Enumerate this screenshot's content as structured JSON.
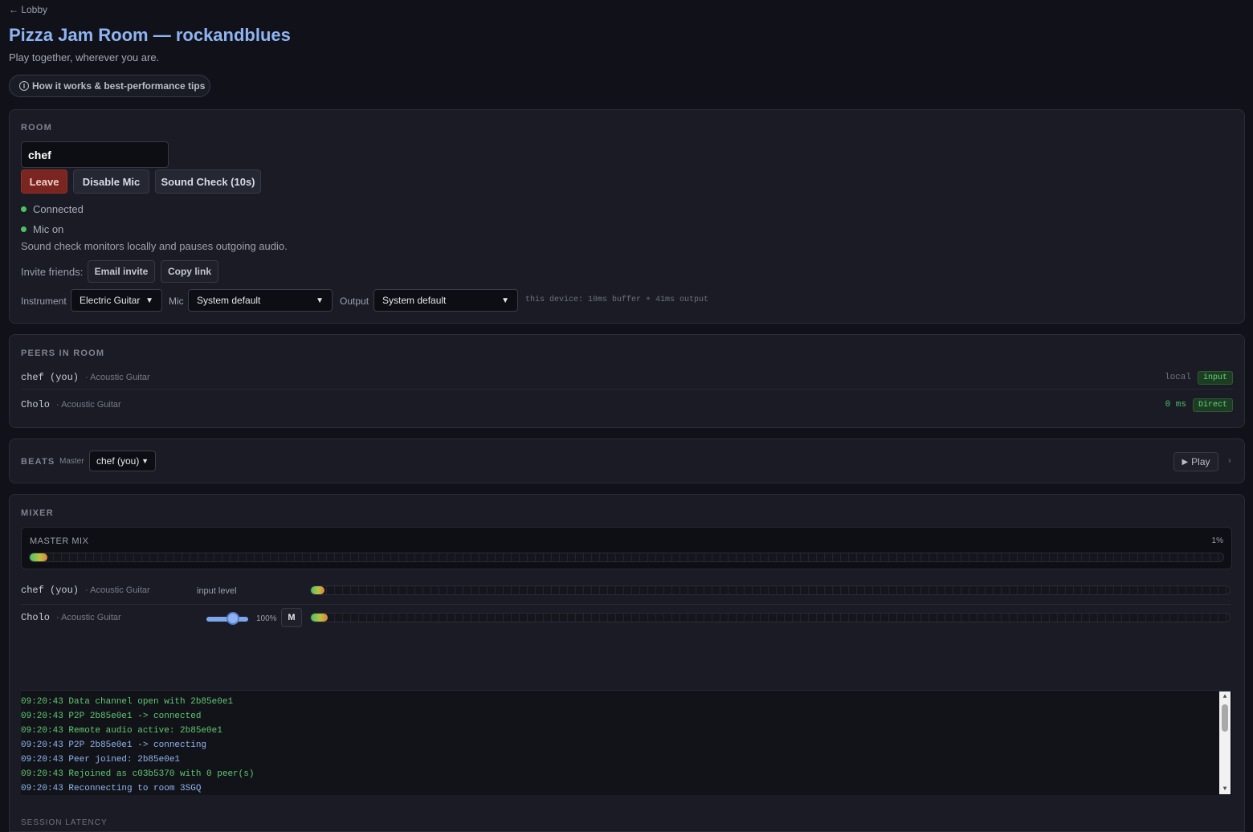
{
  "nav": {
    "back": "← Lobby"
  },
  "header": {
    "title": "Pizza Jam Room — rockandblues",
    "subtitle": "Play together, wherever you are.",
    "help_button": "How it works & best-performance tips"
  },
  "room": {
    "heading": "ROOM",
    "name_value": "chef",
    "buttons": {
      "leave": "Leave",
      "disable_mic": "Disable Mic",
      "sound_check": "Sound Check (10s)"
    },
    "status": {
      "connection": "Connected",
      "mic": "Mic on"
    },
    "note": "Sound check monitors locally and pauses outgoing audio.",
    "invite": {
      "label": "Invite friends:",
      "email": "Email invite",
      "copy": "Copy link"
    },
    "instrument": {
      "label": "Instrument",
      "value": "Electric Guitar"
    },
    "mic": {
      "label": "Mic",
      "value": "System default"
    },
    "output": {
      "label": "Output",
      "value": "System default"
    },
    "device_info": "this device: 10ms buffer + 41ms output"
  },
  "peers": {
    "heading": "PEERS IN ROOM",
    "items": [
      {
        "name": "chef (you)",
        "instrument": "· Acoustic Guitar",
        "stat": "local",
        "tag": "input"
      },
      {
        "name": "Cholo",
        "instrument": "· Acoustic Guitar",
        "stat": "0 ms",
        "tag": "Direct"
      }
    ]
  },
  "beats": {
    "heading": "BEATS",
    "master_label": "Master",
    "master_value": "chef (you)",
    "play": "Play",
    "expand": "›"
  },
  "mixer": {
    "heading": "MIXER",
    "master": {
      "label": "MASTER MIX",
      "percent": "1%",
      "level": 0.015
    },
    "channels": [
      {
        "name": "chef (you)",
        "instrument": "· Acoustic Guitar",
        "sub_label": "input level",
        "level": 0.015
      },
      {
        "name": "Cholo",
        "instrument": "· Acoustic Guitar",
        "volume": "100%",
        "volume_level": 1.0,
        "mute": "M",
        "level": 0.018
      }
    ]
  },
  "log": [
    {
      "text": "09:20:43 Data channel open with 2b85e0e1",
      "color": "green"
    },
    {
      "text": "09:20:43 P2P 2b85e0e1 -> connected",
      "color": "green"
    },
    {
      "text": "09:20:43 Remote audio active: 2b85e0e1",
      "color": "green"
    },
    {
      "text": "09:20:43 P2P 2b85e0e1 -> connecting",
      "color": "blue"
    },
    {
      "text": "09:20:43 Peer joined: 2b85e0e1",
      "color": "blue"
    },
    {
      "text": "09:20:43 Rejoined as c03b5370 with 0 peer(s)",
      "color": "green"
    },
    {
      "text": "09:20:43 Reconnecting to room 3SGQ",
      "color": "blue"
    }
  ],
  "session_latency_heading": "SESSION LATENCY"
}
